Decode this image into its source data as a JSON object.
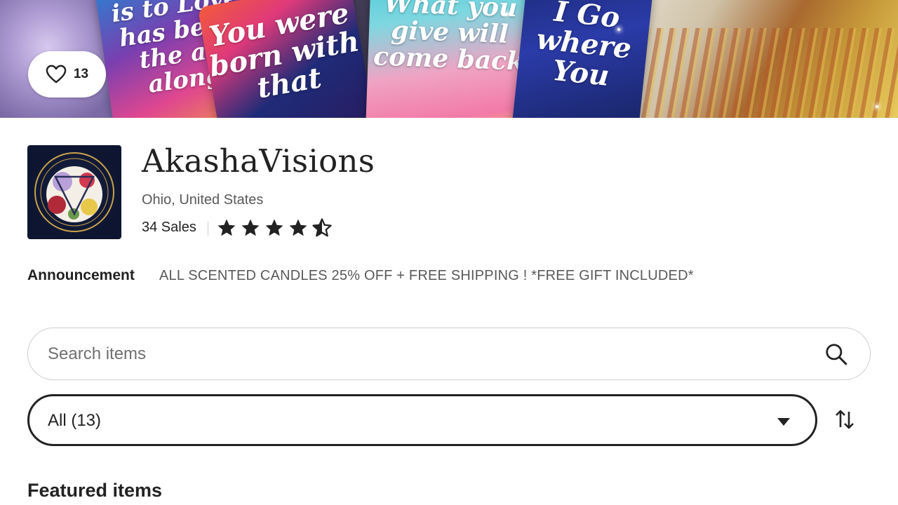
{
  "banner": {
    "cards": [
      {
        "text": "is to Love has been the all along"
      },
      {
        "text": "You were born with that"
      },
      {
        "text": "What you give will come back"
      },
      {
        "text": "I Go where You"
      }
    ]
  },
  "favorite": {
    "count": "13",
    "icon": "heart-outline-icon"
  },
  "shop": {
    "name": "AkashaVisions",
    "location": "Ohio, United States",
    "sales": "34 Sales",
    "rating": 4.5,
    "logo_icon": "shop-logo-image"
  },
  "announcement": {
    "label": "Announcement",
    "text": "ALL SCENTED CANDLES 25% OFF + FREE SHIPPING ! *FREE GIFT INCLUDED*"
  },
  "search": {
    "placeholder": "Search items",
    "value": "",
    "icon": "search-icon"
  },
  "section_filter": {
    "selected": "All (13)",
    "icon": "caret-down-icon"
  },
  "sort": {
    "icon": "sort-arrows-icon"
  },
  "featured": {
    "title": "Featured items"
  },
  "colors": {
    "text": "#222222",
    "muted": "#595959",
    "border": "#cfcfcf"
  }
}
